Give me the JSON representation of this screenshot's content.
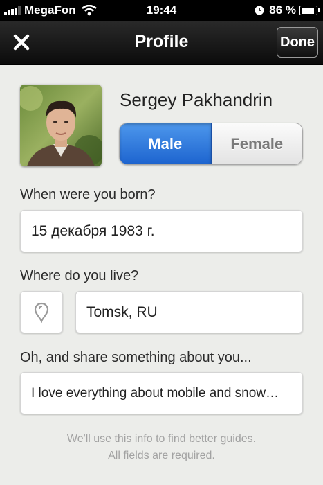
{
  "status_bar": {
    "carrier": "MegaFon",
    "time": "19:44",
    "battery_percent": "86 %",
    "battery_level": 0.86,
    "icons": [
      "signal-icon",
      "wifi-icon",
      "clock-icon",
      "battery-icon"
    ]
  },
  "nav": {
    "title": "Profile",
    "close_icon": "close-icon",
    "done_label": "Done"
  },
  "profile": {
    "name": "Sergey Pakhandrin",
    "gender_options": [
      "Male",
      "Female"
    ],
    "selected_gender": "Male"
  },
  "form": {
    "birth_label": "When were you born?",
    "birth_value": "15 декабря 1983 г.",
    "location_label": "Where do you live?",
    "location_icon": "map-pin-icon",
    "location_value": "Tomsk, RU",
    "about_label": "Oh, and share something about you...",
    "about_value": "I love everything about mobile and snow…"
  },
  "footnote": {
    "line1": "We'll use this info to find better guides.",
    "line2": "All fields are required."
  },
  "colors": {
    "accent": "#2a73d9",
    "background": "#ecedea",
    "navbar": "#111111"
  }
}
